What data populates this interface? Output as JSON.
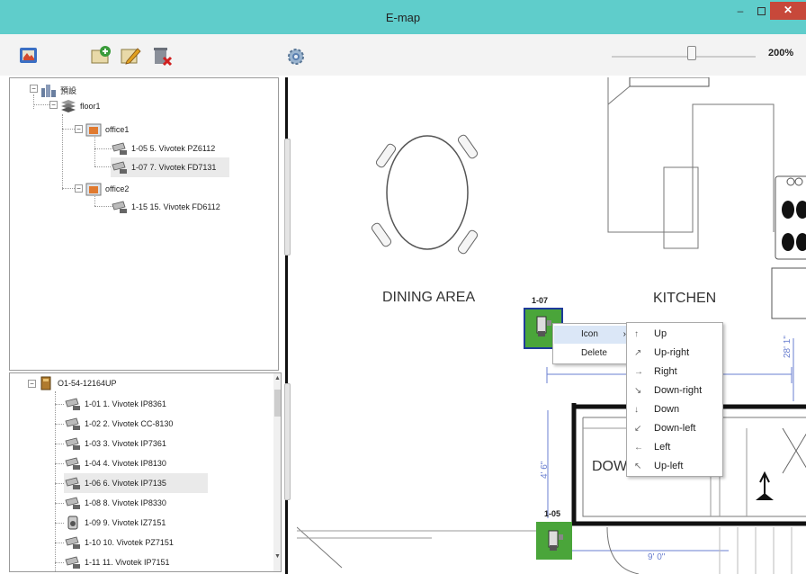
{
  "window": {
    "title": "E-map",
    "min": "–",
    "close": "✕"
  },
  "toolbar": {
    "zoom": "200%"
  },
  "tree_top": {
    "root": "預設",
    "floor": "floor1",
    "office1": "office1",
    "cam_a": "1-05 5. Vivotek PZ6112",
    "cam_b": "1-07 7. Vivotek FD7131",
    "office2": "office2",
    "cam_c": "1-15 15. Vivotek FD6112"
  },
  "tree_bottom": {
    "root": "O1-54-12164UP",
    "items": [
      "1-01 1. Vivotek IP8361",
      "1-02 2. Vivotek CC-8130",
      "1-03 3. Vivotek IP7361",
      "1-04 4. Vivotek IP8130",
      "1-06 6. Vivotek IP7135",
      "1-08 8. Vivotek IP8330",
      "1-09 9. Vivotek IZ7151",
      "1-10 10. Vivotek PZ7151",
      "1-11 11. Vivotek IP7151"
    ]
  },
  "map": {
    "dining": "DINING AREA",
    "kitchen": "KITCHEN",
    "dow": "DOW",
    "dim_right": "28' 1\"",
    "dim_left": "4' 6\"",
    "dim_bottom": "9' 0\"",
    "cam_label_1": "1-07",
    "cam_label_2": "1-05"
  },
  "context_menu": {
    "icon": "Icon",
    "delete": "Delete",
    "arrow": "›"
  },
  "icon_submenu": [
    "Up",
    "Up-right",
    "Right",
    "Down-right",
    "Down",
    "Down-left",
    "Left",
    "Up-left"
  ],
  "colors": {
    "titlebar": "#5fcdcb",
    "close": "#c7483a",
    "camera_bg": "#4aa53a",
    "selection": "#1e3a9a"
  }
}
